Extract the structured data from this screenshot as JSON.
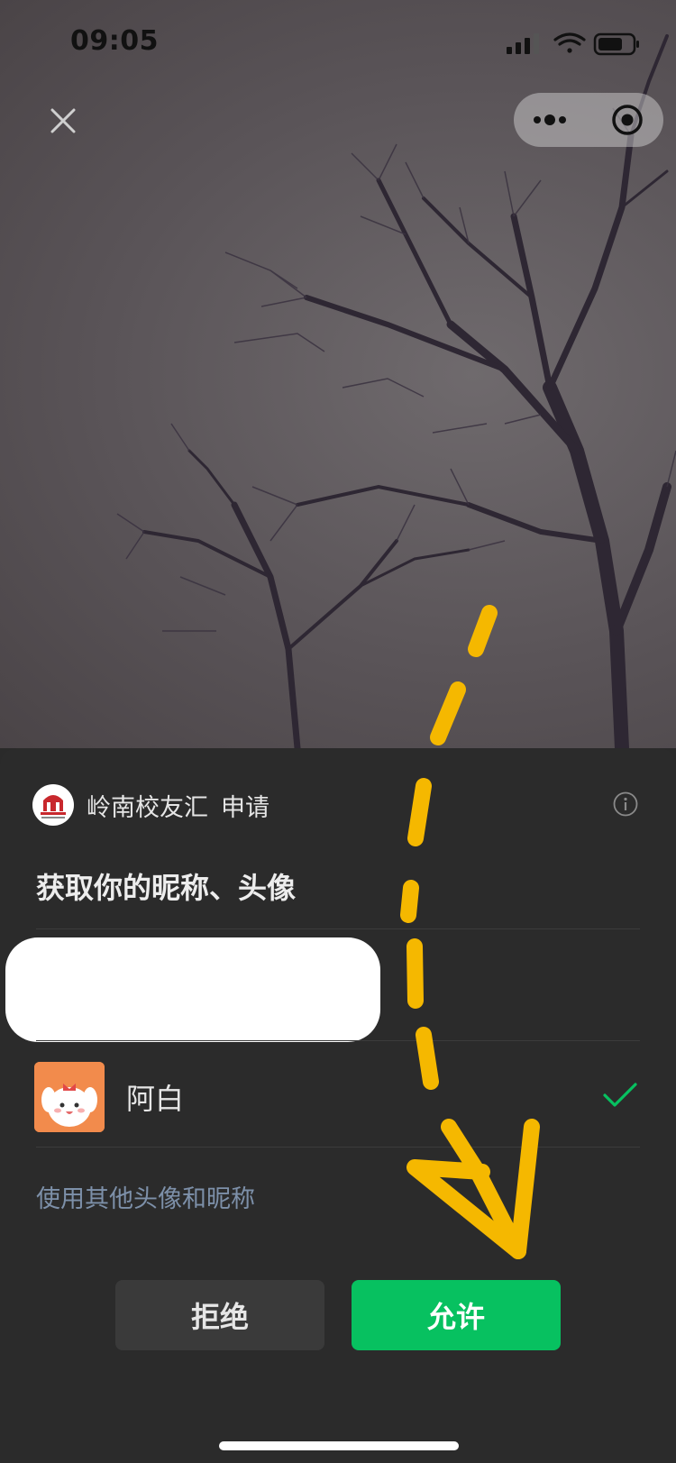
{
  "status_bar": {
    "time": "09:05"
  },
  "icons": {
    "close": "close-icon",
    "more": "more-dots-icon",
    "exit": "target-circle-icon",
    "info": "info-icon",
    "check": "checkmark-icon"
  },
  "sheet": {
    "app_name": "岭南校友汇",
    "request_label": "申请",
    "title": "获取你的昵称、头像",
    "profile": {
      "name": "阿白"
    },
    "use_other": "使用其他头像和昵称",
    "deny_label": "拒绝",
    "allow_label": "允许"
  },
  "colors": {
    "allow": "#07c160",
    "annotation_arrow": "#f5b800",
    "check": "#07c160",
    "link": "#7d90a9"
  }
}
